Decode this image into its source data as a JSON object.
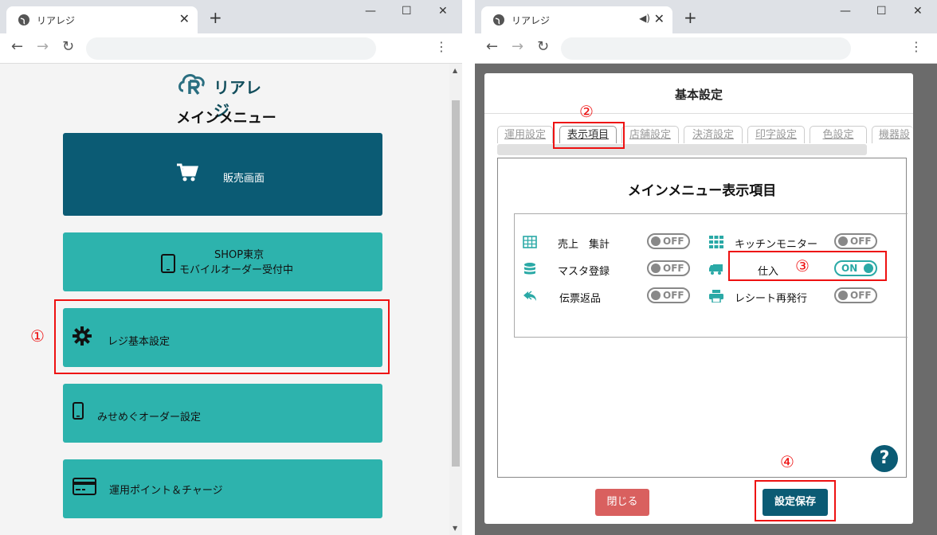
{
  "browser": {
    "tab_title": "リアレジ",
    "new_tab_icon": "plus-icon",
    "minimize": "—",
    "maximize": "☐",
    "close": "✕",
    "back": "←",
    "forward": "→",
    "reload": "↻",
    "menu": "⋮",
    "tab_close": "✕",
    "speaker": "🔈"
  },
  "left": {
    "logo_text": "リアレジ",
    "menu_title": "メインメニュー",
    "buttons": [
      {
        "label": "販売画面",
        "icon": "cart-icon"
      },
      {
        "label_line1": "SHOP東京",
        "label_line2": "モバイルオーダー受付中",
        "icon": "tablet-icon"
      },
      {
        "label": "レジ基本設定",
        "icon": "gear-icon"
      },
      {
        "label": "みせめぐオーダー設定",
        "icon": "phone-icon"
      },
      {
        "label": "運用ポイント＆チャージ",
        "icon": "credit-card-icon"
      }
    ],
    "annotation": "①"
  },
  "right": {
    "modal_title": "基本設定",
    "tabs": [
      "運用設定",
      "表示項目",
      "店舗設定",
      "決済設定",
      "印字設定",
      "色設定",
      "機器設"
    ],
    "active_tab": "表示項目",
    "panel_title": "メインメニュー表示項目",
    "items": [
      {
        "label": "売上　集計",
        "icon": "table-icon",
        "state": "OFF"
      },
      {
        "label": "キッチンモニター",
        "icon": "grid-icon",
        "state": "OFF"
      },
      {
        "label": "マスタ登録",
        "icon": "database-icon",
        "state": "OFF"
      },
      {
        "label": "仕入",
        "icon": "truck-icon",
        "state": "ON"
      },
      {
        "label": "伝票返品",
        "icon": "reply-icon",
        "state": "OFF"
      },
      {
        "label": "レシート再発行",
        "icon": "printer-icon",
        "state": "OFF"
      }
    ],
    "help": "?",
    "close_button": "閉じる",
    "save_button": "設定保存",
    "annotations": [
      "②",
      "③",
      "④"
    ]
  },
  "colors": {
    "teal": "#2db3ad",
    "dark_teal": "#0b5b74",
    "annotation_red": "#e11111",
    "close_red": "#d9605f"
  }
}
